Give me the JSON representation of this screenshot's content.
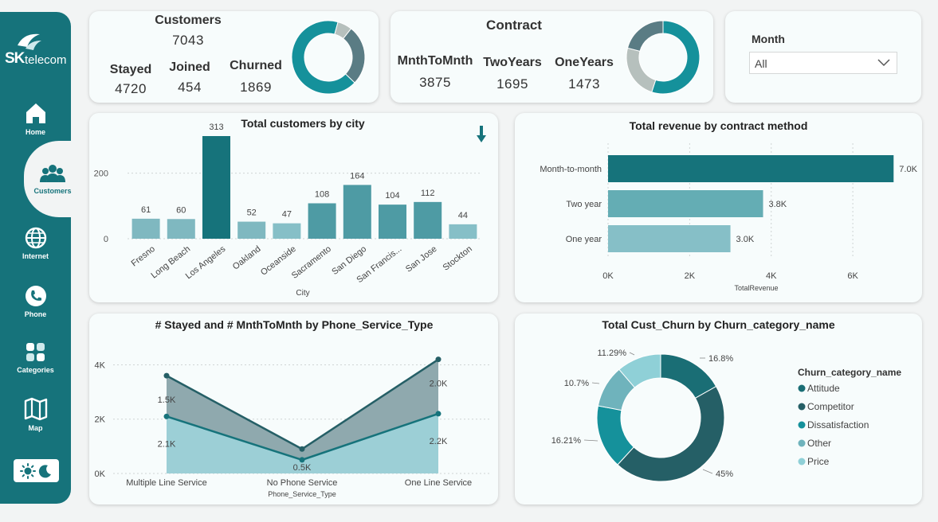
{
  "brand": {
    "logo_sk": "SK",
    "logo_telecom": "telecom"
  },
  "nav": [
    {
      "label": "Home",
      "icon": "home-icon"
    },
    {
      "label": "Customers",
      "icon": "users-icon",
      "active": true
    },
    {
      "label": "Internet",
      "icon": "globe-icon"
    },
    {
      "label": "Phone",
      "icon": "phone-icon"
    },
    {
      "label": "Categories",
      "icon": "grid-icon"
    },
    {
      "label": "Map",
      "icon": "map-icon"
    }
  ],
  "theme_toggle": {
    "icons": [
      "sun-icon",
      "moon-icon"
    ]
  },
  "customers_kpi": {
    "title": "Customers",
    "total": "7043",
    "stayed_label": "Stayed",
    "stayed": "4720",
    "joined_label": "Joined",
    "joined": "454",
    "churned_label": "Churned",
    "churned": "1869"
  },
  "contract_kpi": {
    "title": "Contract",
    "m2m_label": "MnthToMnth",
    "m2m": "3875",
    "two_label": "TwoYears",
    "two": "1695",
    "one_label": "OneYears",
    "one": "1473"
  },
  "month_slicer": {
    "label": "Month",
    "value": "All"
  },
  "colors": {
    "dark": "#16737b",
    "darkest": "#255f66",
    "mid": "#4e9ba4",
    "light": "#86bfc7",
    "lighter": "#9ccfd6",
    "slate": "#5a7c84",
    "grey": "#b6c0bd",
    "teal": "#15919b"
  },
  "chart_data": [
    {
      "type": "pie",
      "id": "customers_donut",
      "categories": [
        "Stayed",
        "Joined",
        "Churned"
      ],
      "values": [
        4720,
        454,
        1869
      ]
    },
    {
      "type": "pie",
      "id": "contract_donut",
      "categories": [
        "MnthToMnth",
        "TwoYears",
        "OneYears"
      ],
      "values": [
        3875,
        1695,
        1473
      ]
    },
    {
      "type": "bar",
      "id": "city_bar",
      "title": "Total customers by city",
      "xlabel": "City",
      "ylabel": "",
      "categories": [
        "Fresno",
        "Long Beach",
        "Los Angeles",
        "Oakland",
        "Oceanside",
        "Sacramento",
        "San Diego",
        "San Francis...",
        "San Jose",
        "Stockton"
      ],
      "values": [
        61,
        60,
        313,
        52,
        47,
        108,
        164,
        104,
        112,
        44
      ],
      "yticks": [
        "0",
        "200"
      ],
      "ylim": [
        0,
        330
      ],
      "grid": true
    },
    {
      "type": "bar",
      "id": "revenue_bar",
      "orientation": "horizontal",
      "title": "Total revenue by contract method",
      "xlabel": "TotalRevenue",
      "categories": [
        "Month-to-month",
        "Two year",
        "One year"
      ],
      "values": [
        7.0,
        3.8,
        3.0
      ],
      "value_labels": [
        "7.0K",
        "3.8K",
        "3.0K"
      ],
      "xticks": [
        "0K",
        "2K",
        "4K",
        "6K"
      ],
      "xlim": [
        0,
        7.6
      ],
      "units": "thousands"
    },
    {
      "type": "area",
      "id": "phone_area",
      "title": "# Stayed and # MnthToMnth by Phone_Service_Type",
      "xlabel": "Phone_Service_Type",
      "categories": [
        "Multiple Line Service",
        "No Phone Service",
        "One Line Service"
      ],
      "series": [
        {
          "values": [
            3.6,
            0.9,
            4.2
          ],
          "labels": [
            "1.5K",
            "",
            "2.0K"
          ]
        },
        {
          "values": [
            2.1,
            0.5,
            2.2
          ],
          "labels": [
            "2.1K",
            "0.5K",
            "2.2K"
          ]
        }
      ],
      "yticks": [
        "0K",
        "2K",
        "4K"
      ],
      "ylim": [
        0,
        4.6
      ],
      "units": "thousands"
    },
    {
      "type": "pie",
      "id": "churn_donut",
      "title": "Total Cust_Churn by Churn_category_name",
      "legend_title": "Churn_category_name",
      "categories": [
        "Attitude",
        "Competitor",
        "Dissatisfaction",
        "Other",
        "Price"
      ],
      "values": [
        16.8,
        45,
        16.21,
        10.7,
        11.29
      ],
      "value_labels": [
        "16.8%",
        "45%",
        "16.21%",
        "10.7%",
        "11.29%"
      ],
      "legend_position": "right"
    }
  ]
}
